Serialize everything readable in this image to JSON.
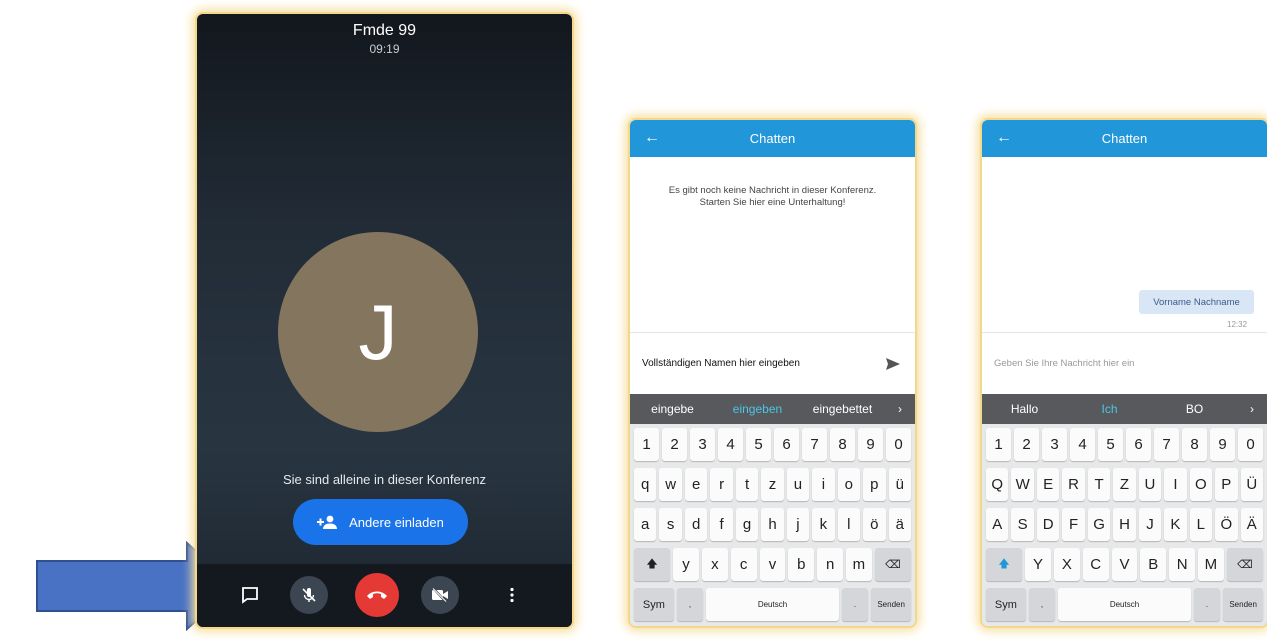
{
  "call": {
    "title": "Fmde 99",
    "time": "09:19",
    "avatar_letter": "J",
    "alone_text": "Sie sind alleine in dieser Konferenz",
    "invite_label": "Andere einladen"
  },
  "chat1": {
    "title": "Chatten",
    "empty_line1": "Es gibt noch keine Nachricht in dieser Konferenz.",
    "empty_line2": "Starten Sie hier eine Unterhaltung!",
    "input_value": "Vollständigen Namen hier eingeben",
    "suggestions": [
      "eingebe",
      "eingeben",
      "eingebettet"
    ],
    "keyboard": {
      "row1": [
        "1",
        "2",
        "3",
        "4",
        "5",
        "6",
        "7",
        "8",
        "9",
        "0"
      ],
      "row2": [
        "q",
        "w",
        "e",
        "r",
        "t",
        "z",
        "u",
        "i",
        "o",
        "p",
        "ü"
      ],
      "row3": [
        "a",
        "s",
        "d",
        "f",
        "g",
        "h",
        "j",
        "k",
        "l",
        "ö",
        "ä"
      ],
      "row4": [
        "y",
        "x",
        "c",
        "v",
        "b",
        "n",
        "m"
      ],
      "sym": "Sym",
      "space": "Deutsch",
      "send": "Senden"
    }
  },
  "chat2": {
    "title": "Chatten",
    "message": "Vorname Nachname",
    "message_time": "12:32",
    "input_placeholder": "Geben Sie Ihre Nachricht hier ein",
    "suggestions": [
      "Hallo",
      "Ich",
      "BO"
    ],
    "keyboard": {
      "row1": [
        "1",
        "2",
        "3",
        "4",
        "5",
        "6",
        "7",
        "8",
        "9",
        "0"
      ],
      "row2": [
        "Q",
        "W",
        "E",
        "R",
        "T",
        "Z",
        "U",
        "I",
        "O",
        "P",
        "Ü"
      ],
      "row3": [
        "A",
        "S",
        "D",
        "F",
        "G",
        "H",
        "J",
        "K",
        "L",
        "Ö",
        "Ä"
      ],
      "row4": [
        "Y",
        "X",
        "C",
        "V",
        "B",
        "N",
        "M"
      ],
      "sym": "Sym",
      "space": "Deutsch",
      "send": "Senden"
    }
  },
  "colors": {
    "accent_blue": "#2196d9",
    "hangup_red": "#e53935",
    "invite_blue": "#1a73e8",
    "arrow_blue": "#4a72c4",
    "highlight_frame": "#f3d88b"
  }
}
